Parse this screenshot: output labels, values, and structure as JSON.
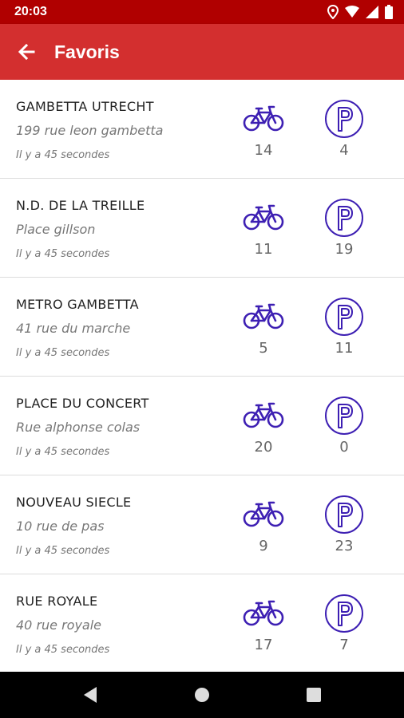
{
  "status_bar": {
    "time": "20:03"
  },
  "app_bar": {
    "title": "Favoris"
  },
  "colors": {
    "status": "#b00000",
    "app_bar": "#d32f2f",
    "icon": "#3d1fb3"
  },
  "stations": [
    {
      "name": "GAMBETTA UTRECHT",
      "address": "199 rue leon gambetta",
      "updated": "Il y a 45 secondes",
      "bikes": "14",
      "parking": "4"
    },
    {
      "name": "N.D. DE LA TREILLE",
      "address": "Place gillson",
      "updated": "Il y a 45 secondes",
      "bikes": "11",
      "parking": "19"
    },
    {
      "name": "METRO GAMBETTA",
      "address": "41 rue du marche",
      "updated": "Il y a 45 secondes",
      "bikes": "5",
      "parking": "11"
    },
    {
      "name": "PLACE DU CONCERT",
      "address": "Rue alphonse colas",
      "updated": "Il y a 45 secondes",
      "bikes": "20",
      "parking": "0"
    },
    {
      "name": "NOUVEAU SIECLE",
      "address": "10 rue de pas",
      "updated": "Il y a 45 secondes",
      "bikes": "9",
      "parking": "23"
    },
    {
      "name": "RUE ROYALE",
      "address": "40 rue royale",
      "updated": "Il y a 45 secondes",
      "bikes": "17",
      "parking": "7"
    }
  ]
}
